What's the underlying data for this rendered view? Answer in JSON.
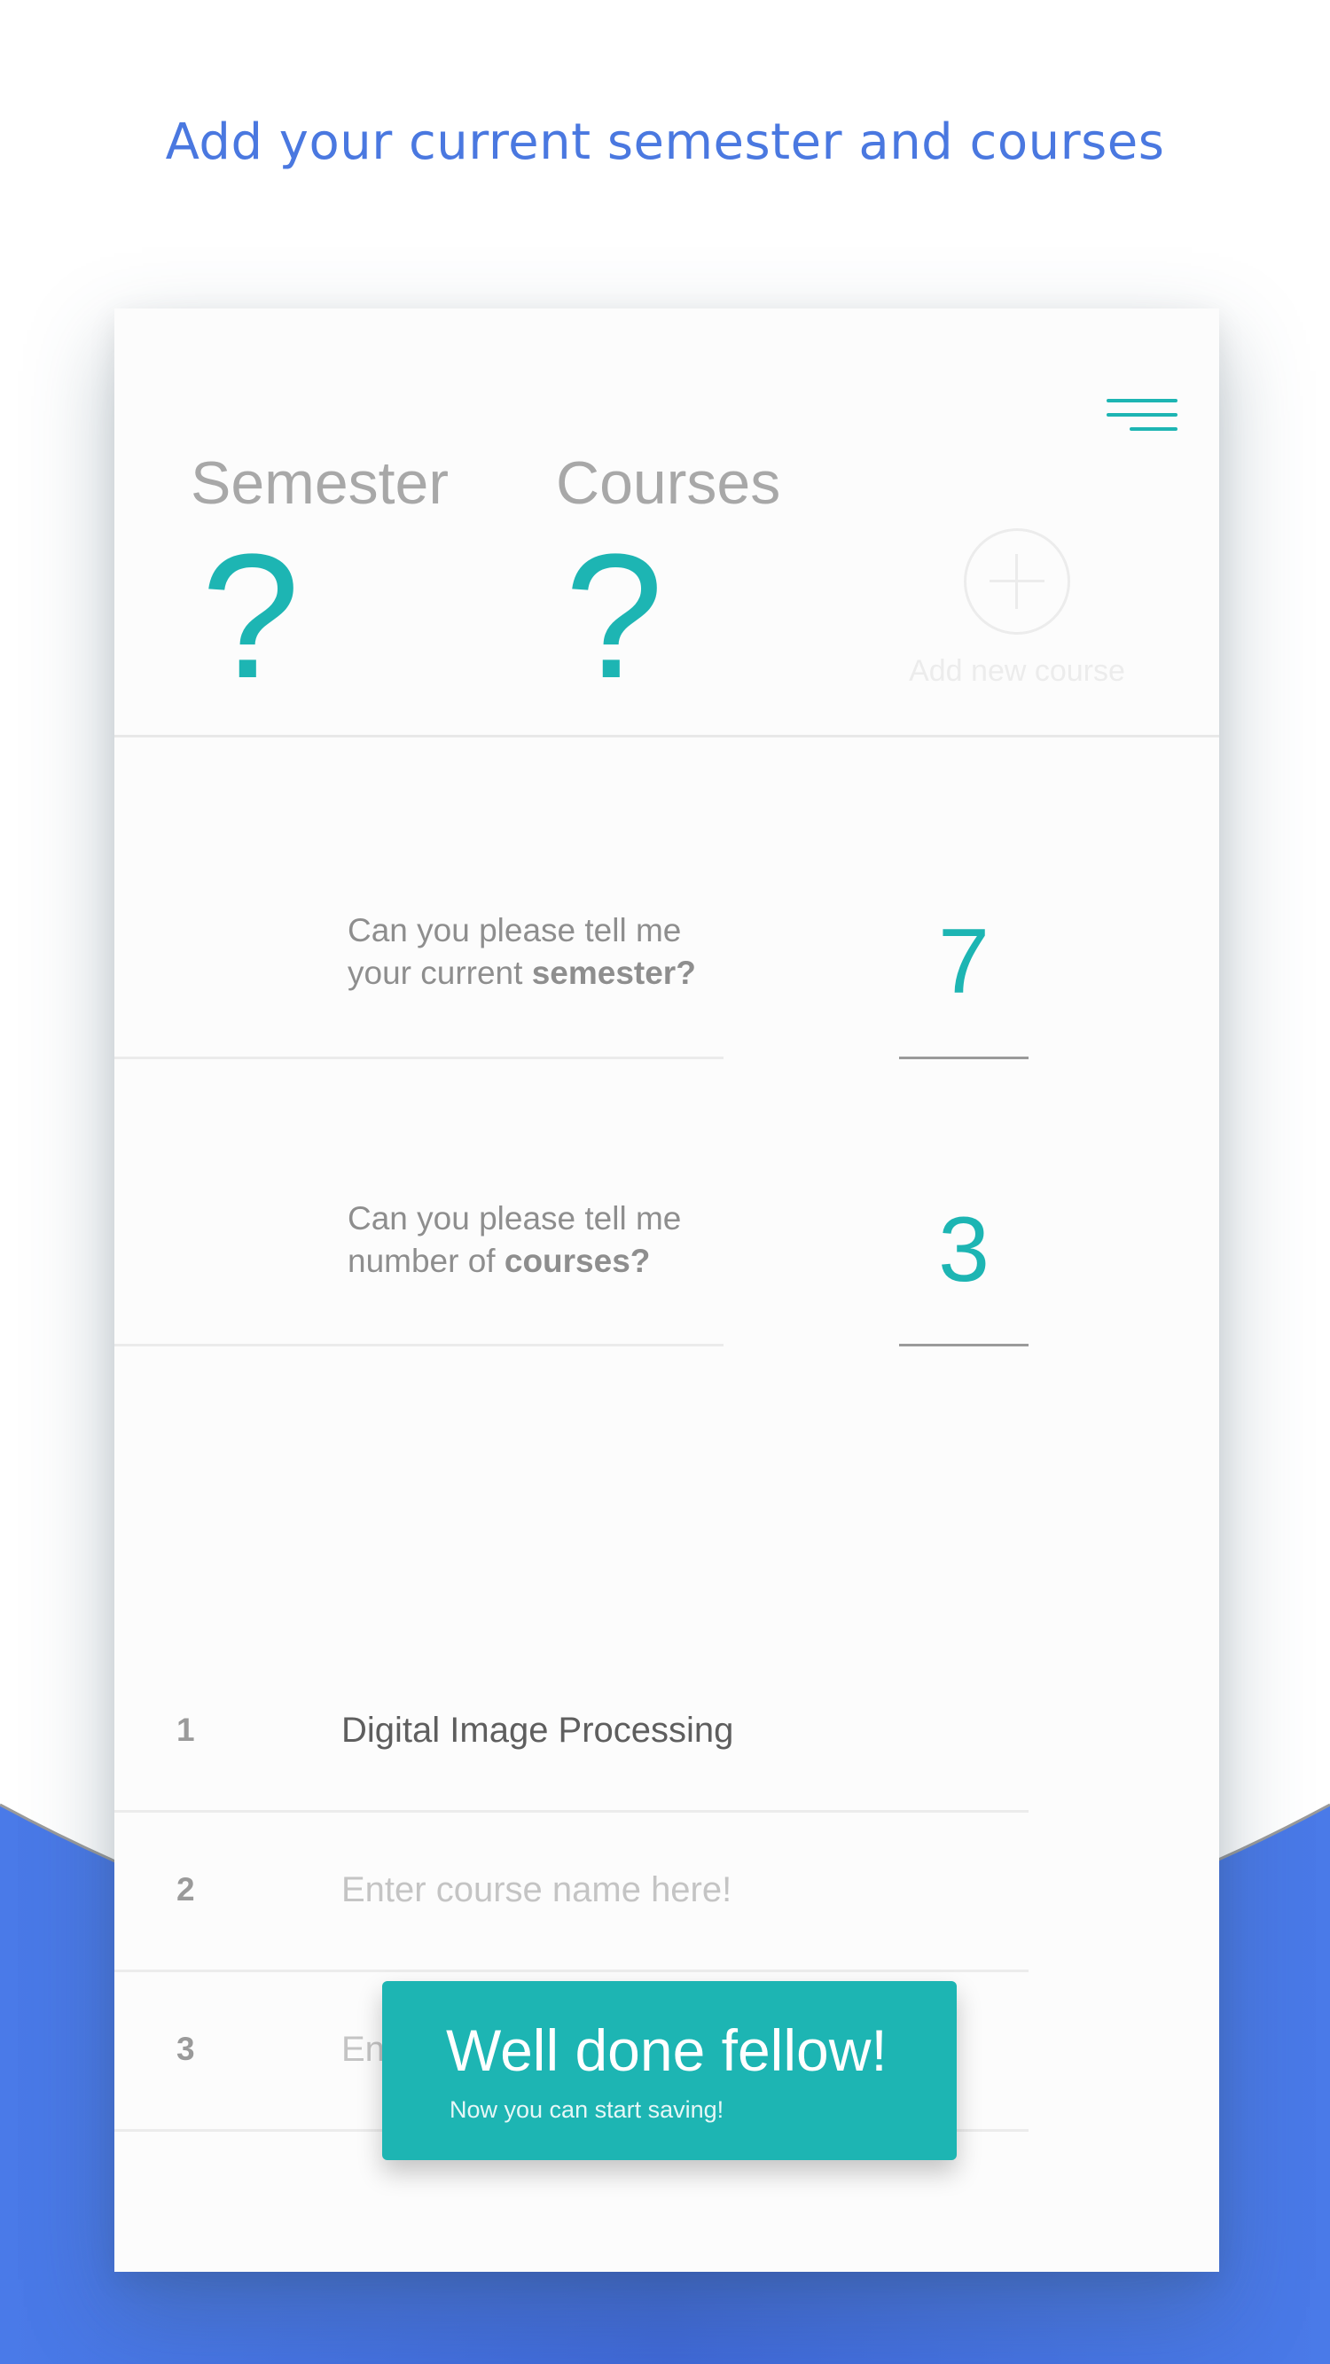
{
  "headline": "Add your current semester and courses",
  "colors": {
    "accent": "#1db5b3",
    "brand_blue": "#4a78e0"
  },
  "header": {
    "menu_icon": "hamburger-icon",
    "semester_label": "Semester",
    "semester_value": "?",
    "courses_label": "Courses",
    "courses_value": "?",
    "add_course_icon": "plus-circle-icon",
    "add_course_label": "Add new course"
  },
  "questions": {
    "semester": {
      "line1": "Can you please tell me",
      "line2_prefix": "your current ",
      "line2_bold": "semester?",
      "answer": "7"
    },
    "courses": {
      "line1": "Can you please tell me",
      "line2_prefix": "number of ",
      "line2_bold": "courses?",
      "answer": "3"
    }
  },
  "courses": [
    {
      "number": "1",
      "name": "Digital Image Processing",
      "placeholder": "Enter course name here!"
    },
    {
      "number": "2",
      "name": "",
      "placeholder": "Enter course name here!"
    },
    {
      "number": "3",
      "name": "",
      "placeholder": "Enter course name here!"
    }
  ],
  "done_button": {
    "title": "Well done fellow!",
    "subtitle": "Now you can start saving!"
  }
}
